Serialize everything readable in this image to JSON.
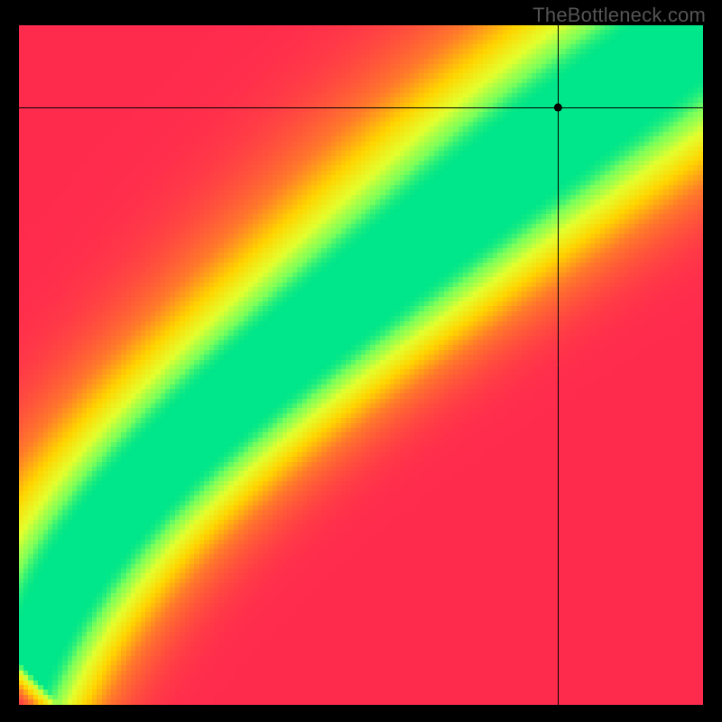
{
  "watermark": "TheBottleneck.com",
  "chart_data": {
    "type": "heatmap",
    "title": "",
    "xlabel": "",
    "ylabel": "",
    "xlim": [
      0,
      1
    ],
    "ylim": [
      0,
      1
    ],
    "grid": false,
    "crosshair": {
      "x": 0.788,
      "y": 0.879
    },
    "marker": {
      "x": 0.788,
      "y": 0.879
    },
    "optimal_curve_description": "Green optimal band runs diagonally from lower-left to upper-right with slight S-curvature; surrounded by yellow falloff, fading to orange then red away from the band. Lower-left corner is red, upper-left is red fading to orange/yellow toward right, lower-right is red fading to orange/yellow upward.",
    "color_stops": [
      {
        "t": 0.0,
        "hex": "#ff2b4d"
      },
      {
        "t": 0.35,
        "hex": "#ff7a2a"
      },
      {
        "t": 0.6,
        "hex": "#ffd400"
      },
      {
        "t": 0.8,
        "hex": "#e3ff2e"
      },
      {
        "t": 0.93,
        "hex": "#7cff5a"
      },
      {
        "t": 1.0,
        "hex": "#00e68a"
      }
    ],
    "band_half_width": 0.055,
    "resolution": 140
  }
}
